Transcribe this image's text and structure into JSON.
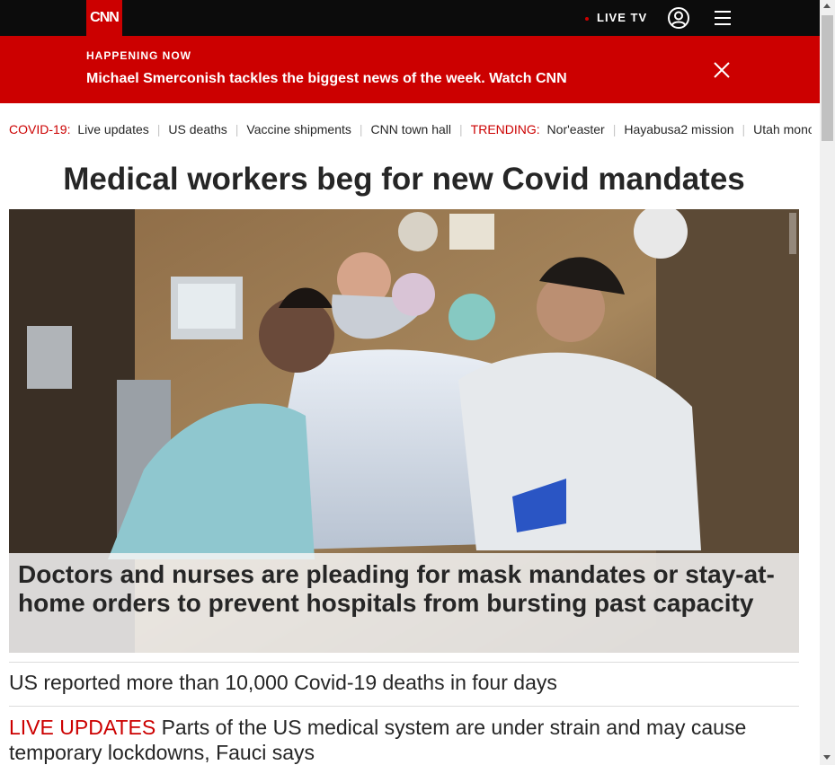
{
  "nav": {
    "logo": "CNN",
    "live_tv": "LIVE TV",
    "user_icon": "user-icon",
    "menu_icon": "hamburger-menu-icon"
  },
  "banner": {
    "kicker": "HAPPENING NOW",
    "text": "Michael Smerconish tackles the biggest news of the week. Watch CNN",
    "close_icon": "close-icon"
  },
  "trending": {
    "covid_label": "COVID-19:",
    "covid_items": [
      "Live updates",
      "US deaths",
      "Vaccine shipments",
      "CNN town hall"
    ],
    "trending_label": "TRENDING:",
    "trending_items": [
      "Nor'easter",
      "Hayabusa2 mission",
      "Utah monolith"
    ]
  },
  "main": {
    "headline": "Medical workers beg for new Covid mandates",
    "hero_caption": "Doctors and nurses are pleading for mask mandates or stay-at-home orders to prevent hospitals from bursting past capacity",
    "stories": [
      {
        "text": "US reported more than 10,000 Covid-19 deaths in four days"
      },
      {
        "tag": "LIVE UPDATES",
        "text": " Parts of the US medical system are under strain and may cause temporary lockdowns, Fauci says"
      }
    ]
  },
  "colors": {
    "brand_red": "#cc0000",
    "topbar": "#0c0c0c",
    "text": "#262626"
  }
}
